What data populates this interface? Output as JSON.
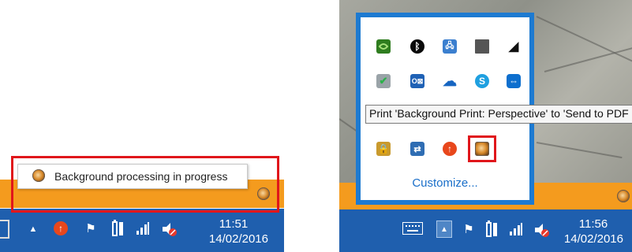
{
  "left": {
    "tooltip_text": "Background processing in progress",
    "clock": {
      "time": "11:51",
      "date": "14/02/2016"
    }
  },
  "right": {
    "tooltip_text": "Print 'Background Print: Perspective' to 'Send to PDF",
    "customize_label": "Customize...",
    "clock": {
      "time": "11:56",
      "date": "14/02/2016"
    }
  },
  "icons": [
    "nvidia-icon",
    "bluetooth-icon",
    "network-adapter-icon",
    "display-icon",
    "speaker-icon",
    "security-check-icon",
    "outlook-icon",
    "onedrive-icon",
    "skype-icon",
    "teamviewer-icon",
    "lock-drive-icon",
    "file-share-icon",
    "update-arrow-icon",
    "background-print-icon"
  ],
  "colors": {
    "taskbar": "#1f5fae",
    "orange_strip": "#f49b1e",
    "highlight_red": "#e0161b",
    "flyout_border": "#1d7ad1",
    "link_blue": "#1a6fc9"
  }
}
